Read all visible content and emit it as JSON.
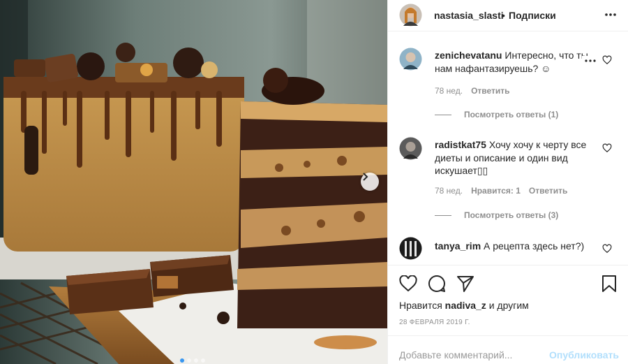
{
  "post": {
    "photo_alt": "cake",
    "carousel": {
      "dot_count": 4,
      "active_index": 0
    },
    "icons": {
      "next": "chevron-right-icon"
    }
  },
  "header": {
    "username": "nastasia_slasti",
    "separator": "•",
    "follow_label": "Подписки",
    "more_icon": "ellipsis-icon"
  },
  "comments": [
    {
      "username": "zenichevatanu",
      "text": "Интересно, что ты нам нафантазируешь? ☺",
      "age": "78 нед.",
      "reply_label": "Ответить",
      "likes_label": "",
      "view_replies": "Посмотреть ответы (1)"
    },
    {
      "username": "radistkat75",
      "text": "Хочу хочу к черту все диеты и описание и один вид искушает▯▯",
      "age": "78 нед.",
      "likes_label": "Нравится: 1",
      "reply_label": "Ответить",
      "view_replies": "Посмотреть ответы (3)"
    },
    {
      "username": "tanya_rim",
      "text": "А рецепта здесь нет?)",
      "age": "",
      "reply_label": "",
      "likes_label": "",
      "view_replies": ""
    }
  ],
  "actions": {
    "like_icon": "heart-icon",
    "comment_icon": "comment-bubble-icon",
    "share_icon": "paper-plane-icon",
    "save_icon": "bookmark-icon",
    "likes_prefix": "Нравится",
    "likes_user": "nadiva_z",
    "likes_suffix": "и другим",
    "date": "28 ФЕВРАЛЯ 2019 Г."
  },
  "add_comment": {
    "placeholder": "Добавьте комментарий...",
    "publish_label": "Опубликовать"
  },
  "colors": {
    "link_blue_disabled": "#b2dffc",
    "secondary_text": "#8e8e8e",
    "primary_text": "#262626",
    "divider": "#efefef",
    "accent": "#3897f0"
  }
}
